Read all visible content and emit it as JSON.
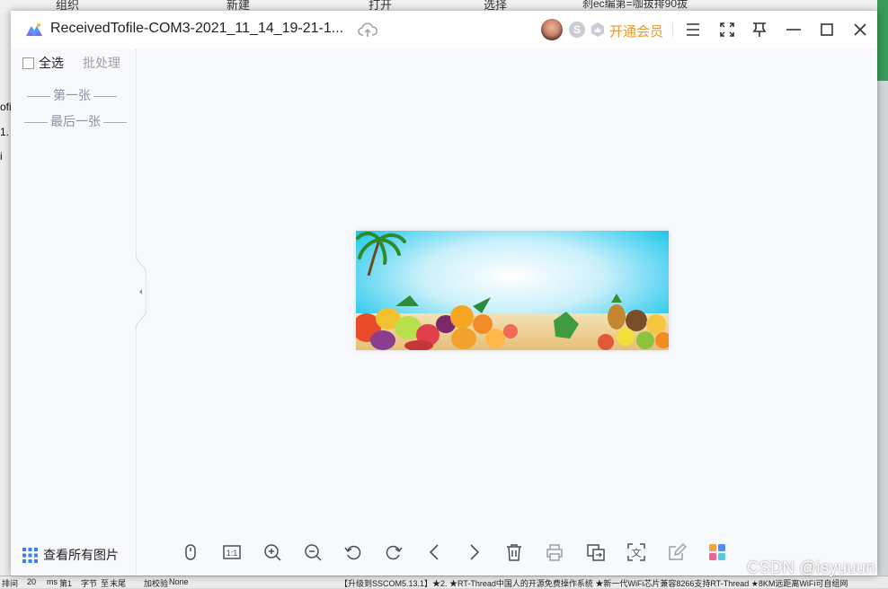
{
  "background": {
    "top_tabs": [
      "组织",
      "新建",
      "打开",
      "选择"
    ],
    "top_right_text": "刹ec编第=咖拔排90拔",
    "left_fragments": [
      "ofi",
      "1.",
      "i"
    ],
    "bottom_fragments": [
      "排间",
      "20",
      "ms",
      "第1",
      "字节",
      "至",
      "末尾",
      "加校验",
      "None"
    ],
    "bottom_marquee": "【升级到SSCOM5.13.1】★2. ★RT-Thread中国人的开源免费操作系统 ★新一代WiFi芯片兼容8266支持RT-Thread ★8KM远距离WiFi可自组网",
    "watermark": "CSDN @isyuuun"
  },
  "window": {
    "title": "ReceivedTofile-COM3-2021_11_14_19-21-1...",
    "vip_label": "开通会员",
    "badge_s": "S",
    "icons": {
      "logo": "app-logo-icon",
      "cloud": "cloud-upload-icon",
      "menu": "menu-icon",
      "fullscreen": "fullscreen-icon",
      "pin": "pin-icon",
      "minimize": "minimize-icon",
      "maximize": "maximize-icon",
      "close": "close-icon"
    }
  },
  "sidebar": {
    "select_all": "全选",
    "batch": "批处理",
    "first": "第一张",
    "last": "最后一张",
    "view_all": "查看所有图片"
  },
  "toolbar": {
    "tools": [
      "mouse-mode",
      "actual-size",
      "zoom-in",
      "zoom-out",
      "rotate-left",
      "rotate-right",
      "previous",
      "next",
      "delete",
      "print",
      "convert",
      "ocr",
      "edit",
      "more-apps"
    ],
    "actual_size_label": "1:1",
    "ocr_label": "文"
  },
  "colors": {
    "accent_vip": "#e39a2c",
    "icon_gray": "#4a4f5a",
    "window_bg": "#f7f9fc"
  }
}
